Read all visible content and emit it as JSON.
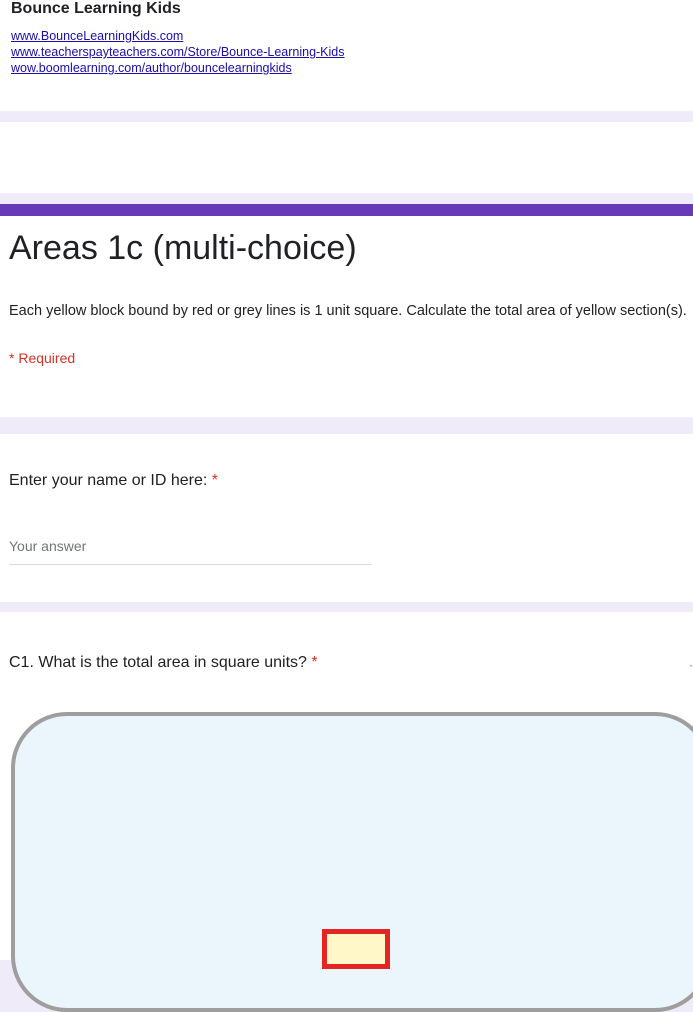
{
  "brand": {
    "title": "Bounce Learning Kids",
    "links": [
      "www.BounceLearningKids.com",
      "www.teacherspayteachers.com/Store/Bounce-Learning-Kids",
      "wow.boomlearning.com/author/bouncelearningkids"
    ]
  },
  "form": {
    "title": "Areas 1c (multi-choice)",
    "description": "Each yellow block bound by red or grey lines is 1 unit square. Calculate the total area of yellow section(s).",
    "required_note": "* Required"
  },
  "questions": [
    {
      "label": "Enter your name or ID here:",
      "required_mark": "*",
      "placeholder": "Your answer"
    },
    {
      "label": "C1. What is the total area in square units?",
      "required_mark": "*"
    }
  ],
  "colors": {
    "accent": "#673ab7",
    "background": "#f0ebf8",
    "required": "#d93025",
    "link": "#1a0dab",
    "square_fill": "#fff7c8",
    "square_border": "#e52424",
    "image_background": "#eaf6fb"
  }
}
